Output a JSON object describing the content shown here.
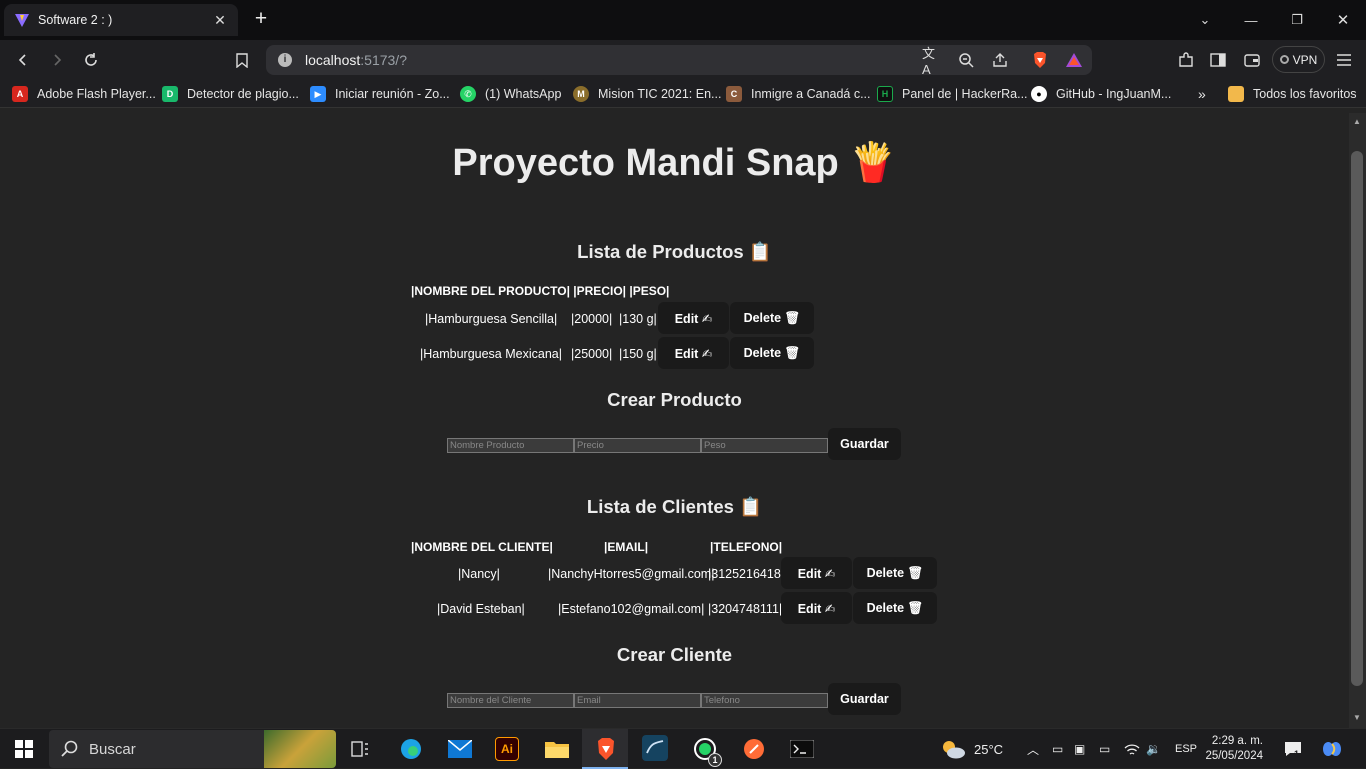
{
  "browser": {
    "tab_title": "Software 2 : )",
    "url_host": "localhost",
    "url_rest": ":5173/?",
    "vpn_label": "VPN",
    "bookmarks": [
      {
        "label": "Adobe Flash Player...",
        "color": "#d7271e"
      },
      {
        "label": "Detector de plagio...",
        "color": "#19b86b"
      },
      {
        "label": "Iniciar reunión - Zo...",
        "color": "#2d8cff"
      },
      {
        "label": "(1) WhatsApp",
        "color": "#25d366"
      },
      {
        "label": "Mision TIC 2021: En...",
        "color": "#8a6d2b"
      },
      {
        "label": "Inmigre a Canadá c...",
        "color": "#8b5a3c"
      },
      {
        "label": "Panel de | HackerRa...",
        "color": "#0f0f0f"
      },
      {
        "label": "GitHub - IngJuanM...",
        "color": "#ffffff"
      }
    ],
    "more_bookmarks": "»",
    "all_favorites": "Todos los favoritos"
  },
  "page": {
    "title": "Proyecto Mandi Snap 🍟",
    "products": {
      "heading": "Lista de Productos 📋",
      "header": "|NOMBRE DEL PRODUCTO| |PRECIO| |PESO|",
      "rows": [
        {
          "name": "|Hamburguesa Sencilla|",
          "price": "|20000|",
          "weight": "|130 g|"
        },
        {
          "name": "|Hamburguesa Mexicana|",
          "price": "|25000|",
          "weight": "|150 g|"
        }
      ],
      "edit_label": "Edit ✍",
      "delete_label": "Delete 🗑"
    },
    "create_product": {
      "heading": "Crear Producto",
      "name_placeholder": "Nombre Producto",
      "price_placeholder": "Precio",
      "weight_placeholder": "Peso",
      "save_label": "Guardar"
    },
    "clients": {
      "heading": "Lista de Clientes 📋",
      "header_name": "|NOMBRE DEL CLIENTE|",
      "header_email": "|EMAIL|",
      "header_phone": "|TELEFONO|",
      "rows": [
        {
          "name": "|Nancy|",
          "email": "|NanchyHtorres5@gmail.com|",
          "phone": "|3125216418|"
        },
        {
          "name": "|David Esteban|",
          "email": "|Estefano102@gmail.com|",
          "phone": "|3204748111|"
        }
      ],
      "edit_label": "Edit ✍",
      "delete_label": "Delete 🗑"
    },
    "create_client": {
      "heading": "Crear Cliente",
      "name_placeholder": "Nombre del Cliente",
      "email_placeholder": "Email",
      "phone_placeholder": "Telefono",
      "save_label": "Guardar"
    }
  },
  "taskbar": {
    "search_label": "Buscar",
    "weather": "25°C",
    "language": "ESP",
    "time": "2:29 a. m.",
    "date": "25/05/2024",
    "notifications": "1",
    "whatsapp_badge": "1"
  }
}
